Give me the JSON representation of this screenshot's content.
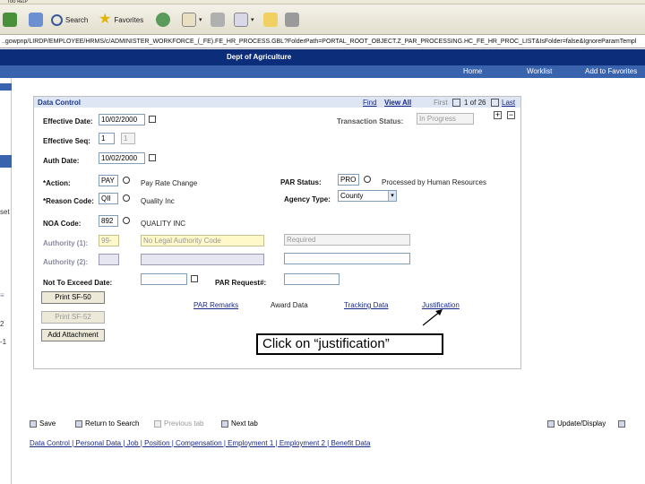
{
  "browser": {
    "menu_text": "ᴛᴏᴏ    ʜᴇʟᴘ",
    "toolbar": {
      "search": "Search",
      "favorites": "Favorites"
    },
    "address": "..gowpnp/LIRDP/EMPLOYEE/HRMS/c/ADMINISTER_WORKFORCE_(_FE).FE_HR_PROCESS.GBL?FolderPath=PORTAL_ROOT_OBJECT.Z_PAR_PROCESSING.HC_FE_HR_PROC_LIST&IsFolder=false&IgnoreParamTempl"
  },
  "header": {
    "site": "Dept of Agriculture",
    "links": {
      "home": "Home",
      "worklist": "Worklist",
      "add_favorites": "Add to Favorites"
    }
  },
  "leftbar": {
    "t1": "set",
    "t2": "≡",
    "t3": "2",
    "t4": "-1"
  },
  "panel": {
    "title": "Data Control",
    "nav": {
      "find": "Find",
      "view_all": "View All",
      "first": "First",
      "count": "1 of 26",
      "last": "Last"
    },
    "labels": {
      "effective_date": "Effective Date:",
      "effective_seq": "Effective Seq:",
      "auth_date": "Auth Date:",
      "action": "*Action:",
      "reason_code": "*Reason Code:",
      "noa_code": "NOA Code:",
      "authority1": "Authority (1):",
      "authority2": "Authority (2):",
      "not_to_exceed": "Not To Exceed Date:",
      "transaction_status": "Transaction Status:",
      "par_status": "PAR Status:",
      "agency_type": "Agency Type:",
      "par_request": "PAR Request#:"
    },
    "values": {
      "effective_date": "10/02/2000",
      "effective_seq_1": "1",
      "effective_seq_2": "1",
      "auth_date": "10/02/2000",
      "action": "PAY",
      "action_desc": "Pay Rate Change",
      "reason_code": "QII",
      "reason_desc": "Quality Inc",
      "noa_code": "892",
      "noa_desc": "QUALITY INC",
      "authority1_code": "99-",
      "authority1_desc": "No Legal Authority Code",
      "authority1_req": "Required",
      "transaction_status": "In Progress",
      "par_status": "PRO",
      "par_status_desc": "Processed by Human Resources",
      "agency_type": "County"
    },
    "buttons": {
      "print1": "Print SF-50",
      "print2": "Print SF-52",
      "attachment": "Add Attachment"
    },
    "links": {
      "remarks": "PAR Remarks",
      "award": "Award Data",
      "tracking": "Tracking Data",
      "justification": "Justification"
    }
  },
  "callout": "Click on “justification”",
  "bottom": {
    "save": "Save",
    "return": "Return to Search",
    "previous": "Previous tab",
    "next": "Next tab",
    "update": "Update/Display",
    "links": "Data Control | Personal Data | Job | Position | Compensation | Employment 1 | Employment 2 | Benefit Data"
  }
}
